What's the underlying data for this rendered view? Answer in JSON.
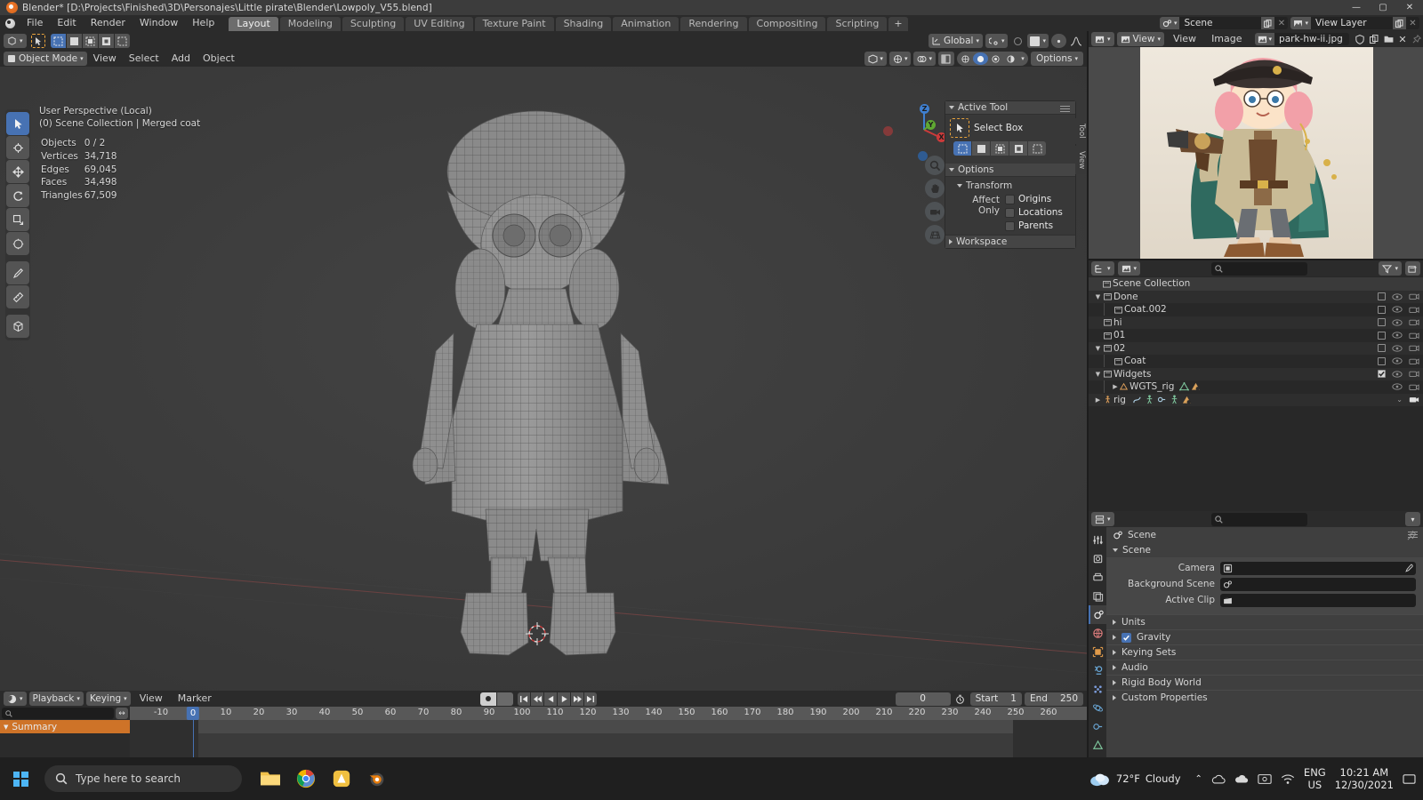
{
  "window": {
    "title": "Blender* [D:\\Projects\\Finished\\3D\\Personajes\\Little pirate\\Blender\\Lowpoly_V55.blend]",
    "minimize": "—",
    "maximize": "▢",
    "close": "✕"
  },
  "topbar": {
    "menus": [
      "File",
      "Edit",
      "Render",
      "Window",
      "Help"
    ],
    "workspaces": [
      "Layout",
      "Modeling",
      "Sculpting",
      "UV Editing",
      "Texture Paint",
      "Shading",
      "Animation",
      "Rendering",
      "Compositing",
      "Scripting"
    ],
    "active_workspace": "Layout",
    "add_workspace": "+",
    "scene_name": "Scene",
    "view_layer_name": "View Layer",
    "new_copy_icon": "duplicate-icon",
    "unlink_icon": "x-icon"
  },
  "viewport": {
    "mode": "Object Mode",
    "menus": [
      "View",
      "Select",
      "Add",
      "Object"
    ],
    "transform_orientation": "Global",
    "options_label": "Options",
    "overlay_text_line1": "User Perspective (Local)",
    "overlay_text_line2": "(0) Scene Collection | Merged coat",
    "stats": [
      {
        "label": "Objects",
        "value": "0 / 2"
      },
      {
        "label": "Vertices",
        "value": "34,718"
      },
      {
        "label": "Edges",
        "value": "69,045"
      },
      {
        "label": "Faces",
        "value": "34,498"
      },
      {
        "label": "Triangles",
        "value": "67,509"
      }
    ],
    "gizmo_axes": [
      "X",
      "Y",
      "Z"
    ],
    "nav_buttons": [
      "zoom-icon",
      "pan-hand-icon",
      "camera-view-icon",
      "perspective-toggle-icon"
    ],
    "npanel_tabs": [
      "Tool",
      "View"
    ],
    "npanel": {
      "active_tool_header": "Active Tool",
      "active_tool_name": "Select Box",
      "options_header": "Options",
      "transform_header": "Transform",
      "affect_only_label": "Affect Only",
      "affect_only_items": [
        "Origins",
        "Locations",
        "Parents"
      ],
      "workspace_header": "Workspace"
    }
  },
  "image_editor": {
    "editor_type": "image-editor-icon",
    "view_mode": "View",
    "menus": [
      "View",
      "Image"
    ],
    "image_name": "park-hw-ii.jpg",
    "fake_user_icon": "shield-icon",
    "new_image_icon": "duplicate-icon",
    "open_image_icon": "folder-icon",
    "unlink_icon": "x-icon",
    "pin_icon": "pin-icon"
  },
  "outliner": {
    "display_mode_icon": "outliner-display-mode-icon",
    "filter_id_icon": "id-type-icon",
    "search_placeholder": "",
    "filter_icon": "funnel-icon",
    "new_collection_icon": "new-collection-icon",
    "root": "Scene Collection",
    "items": [
      {
        "name": "Done",
        "type": "collection",
        "indent": 1,
        "expanded": true,
        "checkbox": false,
        "visible": true,
        "renderable": true
      },
      {
        "name": "Coat.002",
        "type": "collection",
        "indent": 2,
        "expanded": false,
        "checkbox": false,
        "visible": true,
        "renderable": true
      },
      {
        "name": "hi",
        "type": "collection",
        "indent": 1,
        "expanded": false,
        "checkbox": false,
        "visible": true,
        "renderable": true
      },
      {
        "name": "01",
        "type": "collection",
        "indent": 1,
        "expanded": false,
        "checkbox": false,
        "visible": true,
        "renderable": true
      },
      {
        "name": "02",
        "type": "collection",
        "indent": 1,
        "expanded": true,
        "checkbox": false,
        "visible": true,
        "renderable": true
      },
      {
        "name": "Coat",
        "type": "collection",
        "indent": 2,
        "expanded": false,
        "checkbox": false,
        "visible": true,
        "renderable": true
      },
      {
        "name": "Widgets",
        "type": "collection",
        "indent": 1,
        "expanded": true,
        "checkbox": true,
        "visible": true,
        "renderable": true
      },
      {
        "name": "WGTS_rig",
        "type": "object-mesh",
        "indent": 2,
        "expanded": false,
        "checkbox": null,
        "visible": true,
        "renderable": true
      },
      {
        "name": "rig",
        "type": "object-armature",
        "indent": 1,
        "expanded": false,
        "checkbox": null,
        "visible": true,
        "renderable": true
      }
    ]
  },
  "properties": {
    "editor_icon": "properties-editor-icon",
    "search_placeholder": "",
    "tabs": [
      "tool-icon",
      "render-icon",
      "output-icon",
      "view-layer-icon",
      "scene-icon",
      "world-icon",
      "object-icon",
      "modifier-icon",
      "particles-icon",
      "physics-icon",
      "constraints-icon",
      "data-icon",
      "material-icon"
    ],
    "active_tab": "scene-icon",
    "breadcrumb": "Scene",
    "pin_icon": "pin-icon",
    "panels": [
      {
        "name": "Scene",
        "open": true,
        "fields": [
          {
            "label": "Camera",
            "value": "",
            "icon": "camera-object-icon",
            "extra": "eyedropper-icon"
          },
          {
            "label": "Background Scene",
            "value": "",
            "icon": "scene-icon",
            "extra": ""
          },
          {
            "label": "Active Clip",
            "value": "",
            "icon": "clip-icon",
            "extra": ""
          }
        ]
      },
      {
        "name": "Units",
        "open": false,
        "checkbox": null
      },
      {
        "name": "Gravity",
        "open": false,
        "checkbox": true
      },
      {
        "name": "Keying Sets",
        "open": false,
        "checkbox": null
      },
      {
        "name": "Audio",
        "open": false,
        "checkbox": null
      },
      {
        "name": "Rigid Body World",
        "open": false,
        "checkbox": null
      },
      {
        "name": "Custom Properties",
        "open": false,
        "checkbox": null
      }
    ]
  },
  "timeline": {
    "editor_icon": "timeline-editor-icon",
    "menus_dropdowns": [
      "Playback",
      "Keying"
    ],
    "menus": [
      "View",
      "Marker"
    ],
    "record_icon": "record-icon",
    "transport": [
      "jump-start-icon",
      "prev-keyframe-icon",
      "play-reverse-icon",
      "play-icon",
      "next-keyframe-icon",
      "jump-end-icon"
    ],
    "current_frame": "0",
    "use_preview_range_icon": "stopwatch-icon",
    "start_label": "Start",
    "start_value": "1",
    "end_label": "End",
    "end_value": "250",
    "search_placeholder": "",
    "channel_name": "Summary",
    "ruler_ticks": [
      "-10",
      "0",
      "10",
      "20",
      "30",
      "40",
      "50",
      "60",
      "70",
      "80",
      "90",
      "100",
      "110",
      "120",
      "130",
      "140",
      "150",
      "160",
      "170",
      "180",
      "190",
      "200",
      "210",
      "220",
      "230",
      "240",
      "250",
      "260"
    ],
    "playhead_frame": "0"
  },
  "taskbar": {
    "search_placeholder": "Type here to search",
    "apps": [
      "file-explorer-icon",
      "chrome-icon",
      "app-icon",
      "blender-icon"
    ],
    "weather_temp": "72°F",
    "weather_desc": "Cloudy",
    "tray_icons": [
      "chevron-up-icon",
      "onedrive-icon",
      "cloud-icon",
      "screen-icon",
      "network-icon"
    ],
    "language_top": "ENG",
    "language_bottom": "US",
    "time": "10:21 AM",
    "date": "12/30/2021",
    "notification_icon": "notification-icon"
  },
  "colors": {
    "accent_blue": "#4772b3",
    "orange": "#ce7328",
    "panel_bg": "#3f3f3f",
    "header_bg": "#2b2b2b",
    "viewport_bg": "#3b3b3b"
  }
}
